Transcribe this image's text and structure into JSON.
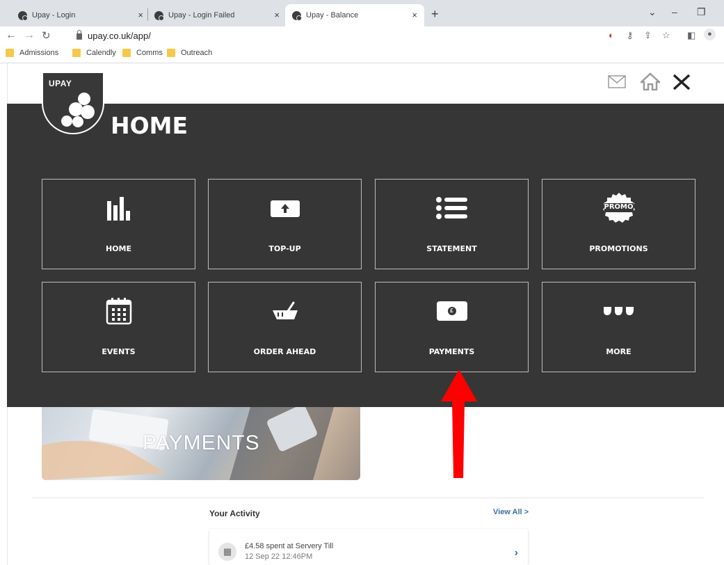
{
  "browser": {
    "tabs": [
      {
        "title": "Upay - Login",
        "close": "×"
      },
      {
        "title": "Upay - Login Failed",
        "close": "×"
      },
      {
        "title": "Upay - Balance",
        "close": "×"
      }
    ],
    "new_tab": "+",
    "url": "upay.co.uk/app/",
    "bookmarks": [
      "Admissions",
      "Calendly",
      "Comms",
      "Outreach"
    ]
  },
  "app": {
    "logo_text": "UPAY",
    "menu_title": "HOME",
    "tiles": [
      {
        "label": "HOME",
        "icon": "bar-chart-icon"
      },
      {
        "label": "TOP-UP",
        "icon": "top-up-icon"
      },
      {
        "label": "STATEMENT",
        "icon": "list-icon"
      },
      {
        "label": "PROMOTIONS",
        "icon": "promo-icon"
      },
      {
        "label": "EVENTS",
        "icon": "calendar-icon"
      },
      {
        "label": "ORDER AHEAD",
        "icon": "basket-icon"
      },
      {
        "label": "PAYMENTS",
        "icon": "payment-icon"
      },
      {
        "label": "MORE",
        "icon": "more-icon"
      }
    ],
    "promo_icon_text": "PROMO",
    "payment_icon_text": "£",
    "banner_text": "PAYMENTS",
    "activity": {
      "title": "Your Activity",
      "view_all": "View All >",
      "items": [
        {
          "line1": "£4.58 spent at Servery Till",
          "line2": "12 Sep 22 12:46PM"
        }
      ]
    }
  },
  "colors": {
    "overlay": "#363636",
    "accent_link": "#3b6ea5",
    "annotation_arrow": "#ff0000"
  }
}
